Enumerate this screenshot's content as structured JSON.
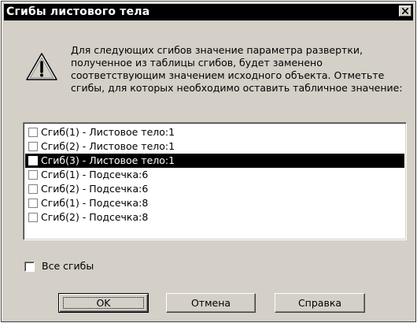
{
  "window": {
    "title": "Сгибы листового тела",
    "close_glyph": "×"
  },
  "icon": "warning-icon",
  "message": {
    "lines": [
      "Для следующих сгибов значение параметра развертки,",
      "полученное из таблицы сгибов, будет заменено",
      "соответствующим значением исходного объекта. Отметьте",
      "сгибы, для которых необходимо оставить табличное значение:"
    ]
  },
  "list": {
    "selected_index": 2,
    "items": [
      {
        "label": "Сгиб(1) -  Листовое тело:1",
        "checked": false
      },
      {
        "label": "Сгиб(2) -  Листовое тело:1",
        "checked": false
      },
      {
        "label": "Сгиб(3) -  Листовое тело:1",
        "checked": false
      },
      {
        "label": "Сгиб(1) -  Подсечка:6",
        "checked": false
      },
      {
        "label": "Сгиб(2) -  Подсечка:6",
        "checked": false
      },
      {
        "label": "Сгиб(1) -  Подсечка:8",
        "checked": false
      },
      {
        "label": "Сгиб(2) -  Подсечка:8",
        "checked": false
      }
    ]
  },
  "all_bends": {
    "label": "Все сгибы",
    "checked": false
  },
  "buttons": {
    "ok": "OK",
    "cancel": "Отмена",
    "help": "Справка"
  },
  "colors": {
    "face": "#d4d0c8",
    "title_bar": "#000000",
    "selection": "#000000"
  }
}
